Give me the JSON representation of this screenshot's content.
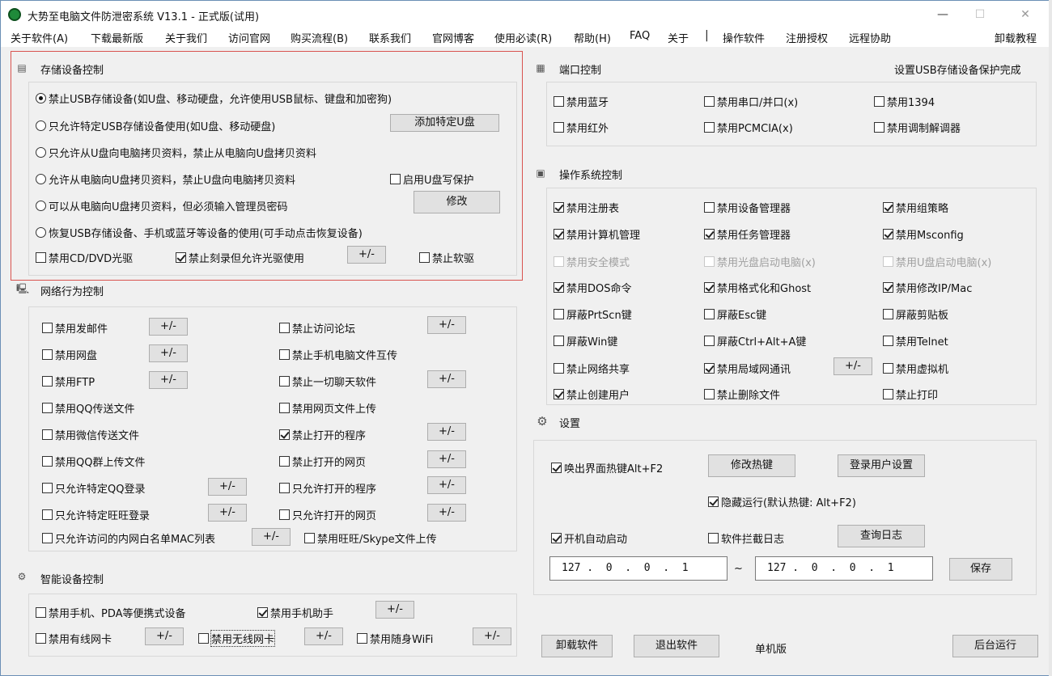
{
  "window": {
    "title": "大势至电脑文件防泄密系统 V13.1 - 正式版(试用)",
    "min_glyph": "—",
    "max_glyph": "☐",
    "close_glyph": "✕"
  },
  "menu": {
    "items": [
      "关于软件(A)",
      "下载最新版",
      "关于我们",
      "访问官网",
      "购买流程(B)",
      "联系我们",
      "官网博客",
      "使用必读(R)",
      "帮助(H)",
      "FAQ",
      "关于",
      "操作软件",
      "注册授权",
      "远程协助"
    ],
    "separator": "|",
    "right": "卸载教程"
  },
  "storage": {
    "title": "存储设备控制",
    "options": [
      {
        "label": "禁止USB存储设备(如U盘、移动硬盘，允许使用USB鼠标、键盘和加密狗)",
        "selected": true
      },
      {
        "label": "只允许特定USB存储设备使用(如U盘、移动硬盘)",
        "selected": false
      },
      {
        "label": "只允许从U盘向电脑拷贝资料，禁止从电脑向U盘拷贝资料",
        "selected": false
      },
      {
        "label": "允许从电脑向U盘拷贝资料，禁止U盘向电脑拷贝资料",
        "selected": false
      },
      {
        "label": "可以从电脑向U盘拷贝资料，但必须输入管理员密码",
        "selected": false
      },
      {
        "label": "恢复USB存储设备、手机或蓝牙等设备的使用(可手动点击恢复设备)",
        "selected": false
      }
    ],
    "add_button": "添加特定U盘",
    "write_protect": "启用U盘写保护",
    "modify_button": "修改",
    "cd_dvd": "禁用CD/DVD光驱",
    "burn": "禁止刻录但允许光驱使用",
    "plusminus": "+/-",
    "floppy": "禁止软驱"
  },
  "network": {
    "title": "网络行为控制",
    "left": [
      {
        "label": "禁用发邮件",
        "checked": false
      },
      {
        "label": "禁用网盘",
        "checked": false
      },
      {
        "label": "禁用FTP",
        "checked": false
      },
      {
        "label": "禁用QQ传送文件",
        "checked": false
      },
      {
        "label": "禁用微信传送文件",
        "checked": false
      },
      {
        "label": "禁用QQ群上传文件",
        "checked": false
      },
      {
        "label": "只允许特定QQ登录",
        "checked": false
      },
      {
        "label": "只允许特定旺旺登录",
        "checked": false
      },
      {
        "label": "只允许访问的内网白名单MAC列表",
        "checked": false
      }
    ],
    "right": [
      {
        "label": "禁止访问论坛",
        "checked": false
      },
      {
        "label": "禁止手机电脑文件互传",
        "checked": false
      },
      {
        "label": "禁止一切聊天软件",
        "checked": false
      },
      {
        "label": "禁用网页文件上传",
        "checked": false
      },
      {
        "label": "禁止打开的程序",
        "checked": true
      },
      {
        "label": "禁止打开的网页",
        "checked": false
      },
      {
        "label": "只允许打开的程序",
        "checked": false
      },
      {
        "label": "只允许打开的网页",
        "checked": false
      },
      {
        "label": "禁用旺旺/Skype文件上传",
        "checked": false
      }
    ],
    "plusminus": "+/-"
  },
  "smart": {
    "title": "智能设备控制",
    "portable": "禁用手机、PDA等便携式设备",
    "assistant": "禁用手机助手",
    "wired": "禁用有线网卡",
    "wireless": "禁用无线网卡",
    "wifi": "禁用随身WiFi",
    "plusminus": "+/-"
  },
  "port": {
    "title": "端口控制",
    "status": "设置USB存储设备保护完成",
    "items": [
      "禁用蓝牙",
      "禁用串口/并口(x)",
      "禁用1394",
      "禁用红外",
      "禁用PCMCIA(x)",
      "禁用调制解调器"
    ]
  },
  "os": {
    "title": "操作系统控制",
    "items": [
      {
        "label": "禁用注册表",
        "checked": true,
        "disabled": false
      },
      {
        "label": "禁用设备管理器",
        "checked": false,
        "disabled": false
      },
      {
        "label": "禁用组策略",
        "checked": true,
        "disabled": false
      },
      {
        "label": "禁用计算机管理",
        "checked": true,
        "disabled": false
      },
      {
        "label": "禁用任务管理器",
        "checked": true,
        "disabled": false
      },
      {
        "label": "禁用Msconfig",
        "checked": true,
        "disabled": false
      },
      {
        "label": "禁用安全模式",
        "checked": false,
        "disabled": true
      },
      {
        "label": "禁用光盘启动电脑(x)",
        "checked": false,
        "disabled": true
      },
      {
        "label": "禁用U盘启动电脑(x)",
        "checked": false,
        "disabled": true
      },
      {
        "label": "禁用DOS命令",
        "checked": true,
        "disabled": false
      },
      {
        "label": "禁用格式化和Ghost",
        "checked": true,
        "disabled": false
      },
      {
        "label": "禁用修改IP/Mac",
        "checked": true,
        "disabled": false
      },
      {
        "label": "屏蔽PrtScn键",
        "checked": false,
        "disabled": false
      },
      {
        "label": "屏蔽Esc键",
        "checked": false,
        "disabled": false
      },
      {
        "label": "屏蔽剪贴板",
        "checked": false,
        "disabled": false
      },
      {
        "label": "屏蔽Win键",
        "checked": false,
        "disabled": false
      },
      {
        "label": "屏蔽Ctrl+Alt+A键",
        "checked": false,
        "disabled": false
      },
      {
        "label": "禁用Telnet",
        "checked": false,
        "disabled": false
      },
      {
        "label": "禁止网络共享",
        "checked": false,
        "disabled": false
      },
      {
        "label": "禁用局域网通讯",
        "checked": true,
        "disabled": false
      },
      {
        "label": "禁用虚拟机",
        "checked": false,
        "disabled": false
      },
      {
        "label": "禁止创建用户",
        "checked": true,
        "disabled": false
      },
      {
        "label": "禁止删除文件",
        "checked": false,
        "disabled": false
      },
      {
        "label": "禁止打印",
        "checked": false,
        "disabled": false
      }
    ],
    "plusminus": "+/-"
  },
  "settings": {
    "title": "设置",
    "hotkey": "唤出界面热键Alt+F2",
    "modify_hotkey": "修改热键",
    "login_settings": "登录用户设置",
    "hidden_run": "隐藏运行(默认热键: Alt+F2)",
    "autostart": "开机自动启动",
    "intercept_log": "软件拦截日志",
    "query_log": "查询日志",
    "ip_from": "127 .  0  .  0  .  1",
    "tilde": "~",
    "ip_to": "127 .  0  .  0  .  1",
    "save": "保存"
  },
  "footer": {
    "uninstall": "卸载软件",
    "exit": "退出软件",
    "mode": "单机版",
    "background": "后台运行"
  }
}
